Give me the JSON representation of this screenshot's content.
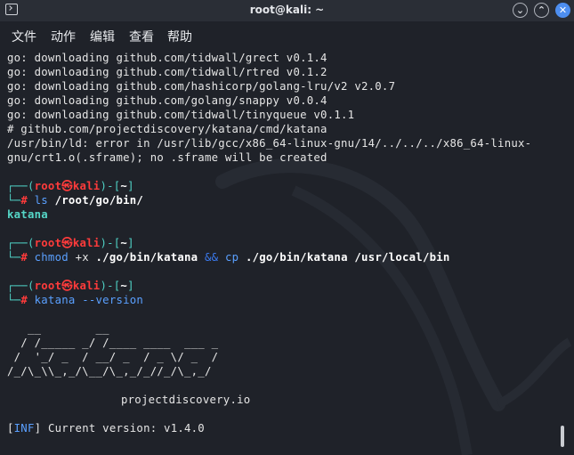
{
  "window": {
    "title": "root@kali: ~"
  },
  "menu": {
    "file": "文件",
    "action": "动作",
    "edit": "编辑",
    "view": "查看",
    "help": "帮助"
  },
  "output": [
    "go: downloading github.com/tidwall/grect v0.1.4",
    "go: downloading github.com/tidwall/rtred v0.1.2",
    "go: downloading github.com/hashicorp/golang-lru/v2 v2.0.7",
    "go: downloading github.com/golang/snappy v0.0.4",
    "go: downloading github.com/tidwall/tinyqueue v0.1.1",
    "# github.com/projectdiscovery/katana/cmd/katana",
    "/usr/bin/ld: error in /usr/lib/gcc/x86_64-linux-gnu/14/../../../x86_64-linux-",
    "gnu/crt1.o(.sframe); no .sframe will be created"
  ],
  "prompt": {
    "open": "┌──(",
    "user": "root",
    "at": "㉿",
    "host": "kali",
    "close": ")-[",
    "dir": "~",
    "end": "]",
    "corner": "└─",
    "hash": "#"
  },
  "commands": {
    "cmd1": {
      "name": "ls",
      "arg": "/root/go/bin/"
    },
    "cmd1_output": "katana",
    "cmd2": {
      "name": "chmod",
      "arg1": "+x",
      "arg2": "./go/bin/katana",
      "op": "&&",
      "name2": "cp",
      "arg3": "./go/bin/katana",
      "arg4": "/usr/local/bin"
    },
    "cmd3": {
      "name": "katana",
      "flag": "--version"
    }
  },
  "banner": [
    "   __        __",
    "  / /_____ _/ /____ ____  ___ _",
    " /  '_/ _  / __/ _  / _ \\/ _  /",
    "/_/\\_\\\\_,_/\\__/\\_,_/_//_/\\_,_/"
  ],
  "banner_footer": "projectdiscovery.io",
  "version": {
    "tag": "INF",
    "text": "Current version: v1.4.0"
  },
  "colors": {
    "background": "#1f2229",
    "prompt_frame": "#4fd1c5",
    "user": "#ff3b3b",
    "path": "#3b7bf2"
  }
}
